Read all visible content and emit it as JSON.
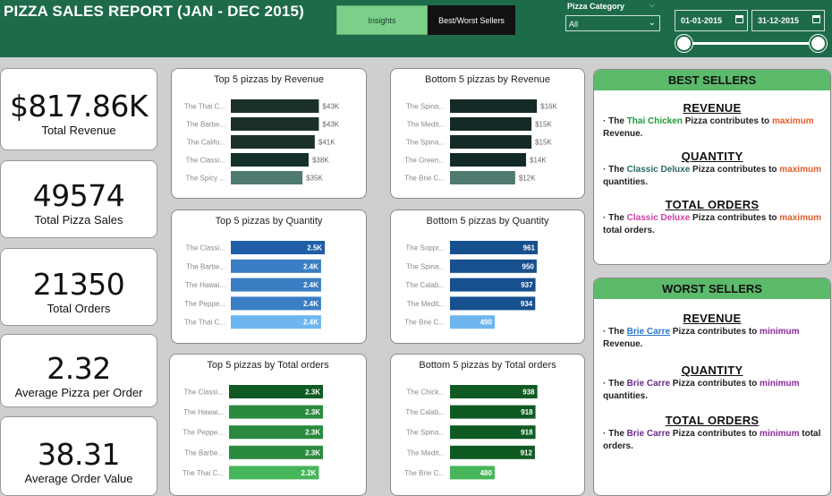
{
  "header": {
    "title": "PIZZA SALES REPORT (JAN - DEC 2015)",
    "nav_insights": "Insights",
    "nav_best_worst": "Best/Worst Sellers",
    "filter_label": "Pizza Category",
    "filter_value": "All",
    "date_from": "01-01-2015",
    "date_to": "31-12-2015"
  },
  "kpis": [
    {
      "value": "$817.86K",
      "label": "Total Revenue"
    },
    {
      "value": "49574",
      "label": "Total Pizza Sales"
    },
    {
      "value": "21350",
      "label": "Total Orders"
    },
    {
      "value": "2.32",
      "label": "Average Pizza per Order"
    },
    {
      "value": "38.31",
      "label": "Average Order Value"
    }
  ],
  "chart_data": [
    {
      "type": "bar",
      "title": "Top 5 pizzas by Revenue",
      "categories": [
        "The Thai C...",
        "The Barbe...",
        "The Califo...",
        "The Classi...",
        "The Spicy ..."
      ],
      "values": [
        43,
        43,
        41,
        38,
        35
      ],
      "labels": [
        "$43K",
        "$43K",
        "$41K",
        "$38K",
        "$35K"
      ],
      "max": 45,
      "colors": [
        "#1b302b",
        "#1b302b",
        "#1b302b",
        "#14302b",
        "#4e7a70"
      ],
      "label_inside": false
    },
    {
      "type": "bar",
      "title": "Bottom 5 pizzas by Revenue",
      "categories": [
        "The Spina...",
        "The Medit...",
        "The Spina...",
        "The Green...",
        "The Brie C..."
      ],
      "values": [
        16,
        15,
        15,
        14,
        12
      ],
      "labels": [
        "$16K",
        "$15K",
        "$15K",
        "$14K",
        "$12K"
      ],
      "max": 16.8,
      "colors": [
        "#142a26",
        "#142a26",
        "#142a26",
        "#142a26",
        "#4e7a70"
      ],
      "label_inside": false
    },
    {
      "type": "bar",
      "title": "Top 5 pizzas by Quantity",
      "categories": [
        "The Classi...",
        "The Barbe...",
        "The Hawai...",
        "The Peppe...",
        "The Thai C..."
      ],
      "values": [
        2.5,
        2.4,
        2.4,
        2.4,
        2.4
      ],
      "labels": [
        "2.5K",
        "2.4K",
        "2.4K",
        "2.4K",
        "2.4K"
      ],
      "max": 2.45,
      "colors": [
        "#1f5fa8",
        "#3a7ec4",
        "#3a7ec4",
        "#3a7ec4",
        "#6db6f0"
      ],
      "label_inside": true
    },
    {
      "type": "bar",
      "title": "Bottom 5 pizzas by Quantity",
      "categories": [
        "The Soppr...",
        "The Spina...",
        "The Calab...",
        "The Medit...",
        "The Brie C..."
      ],
      "values": [
        961,
        950,
        937,
        934,
        490
      ],
      "labels": [
        "961",
        "950",
        "937",
        "934",
        "490"
      ],
      "max": 1000,
      "colors": [
        "#17508f",
        "#17508f",
        "#17508f",
        "#17508f",
        "#6db6f0"
      ],
      "label_inside": true
    },
    {
      "type": "bar",
      "title": "Top 5 pizzas by Total orders",
      "categories": [
        "The Classi...",
        "The Hawai...",
        "The Peppe...",
        "The Barbe...",
        "The Thai C..."
      ],
      "values": [
        2.3,
        2.3,
        2.3,
        2.3,
        2.2
      ],
      "labels": [
        "2.3K",
        "2.3K",
        "2.3K",
        "2.3K",
        "2.2K"
      ],
      "max": 2.3,
      "colors": [
        "#0f5a22",
        "#2a8a3e",
        "#2a8a3e",
        "#2a8a3e",
        "#46b65a"
      ],
      "label_inside": true
    },
    {
      "type": "bar",
      "title": "Bottom 5 pizzas by Total orders",
      "categories": [
        "The Chick...",
        "The Calab...",
        "The Spina...",
        "The Medit...",
        "The Brie C..."
      ],
      "values": [
        938,
        918,
        918,
        912,
        480
      ],
      "labels": [
        "938",
        "918",
        "918",
        "912",
        "480"
      ],
      "max": 980,
      "colors": [
        "#0f5a22",
        "#0f5a22",
        "#0f5a22",
        "#0f5a22",
        "#46b65a"
      ],
      "label_inside": true
    }
  ],
  "best_sellers": {
    "header": "BEST SELLERS",
    "revenue_title": "REVENUE",
    "quantity_title": "QUANTITY",
    "orders_title": "TOTAL ORDERS",
    "revenue_pre": "· The ",
    "revenue_name": "Thai Chicken",
    "revenue_mid": " Pizza contributes to ",
    "revenue_kw": "maximum",
    "revenue_post": " Revenue.",
    "quantity_pre": "· The ",
    "quantity_name": "Classic Deluxe",
    "quantity_mid": " Pizza contributes to ",
    "quantity_kw": "maximum",
    "quantity_post": " quantities.",
    "orders_pre": "· The ",
    "orders_name": "Classic Deluxe",
    "orders_mid": " Pizza contributes to ",
    "orders_kw": "maximum",
    "orders_post": " total orders."
  },
  "worst_sellers": {
    "header": "WORST SELLERS",
    "revenue_title": "REVENUE",
    "quantity_title": "QUANTITY",
    "orders_title": "TOTAL ORDERS",
    "revenue_pre": "· The ",
    "revenue_name": "Brie Carre",
    "revenue_mid": " Pizza contributes to ",
    "revenue_kw": "minimum",
    "revenue_post": " Revenue.",
    "quantity_pre": "· The ",
    "quantity_name": "Brie Carre",
    "quantity_mid": " Pizza contributes to ",
    "quantity_kw": "minimum",
    "quantity_post": " quantities.",
    "orders_pre": "· The ",
    "orders_name": "Brie Carre",
    "orders_mid": " Pizza contributes to ",
    "orders_kw": "minimum",
    "orders_post": " total orders."
  },
  "colors": {
    "header_bg": "#1e6b4a",
    "panel_head": "#5cba6b",
    "nav_active": "#7ccf8b"
  },
  "icons": {
    "calendar": "calendar-icon",
    "chevron": "chevron-down-icon"
  }
}
